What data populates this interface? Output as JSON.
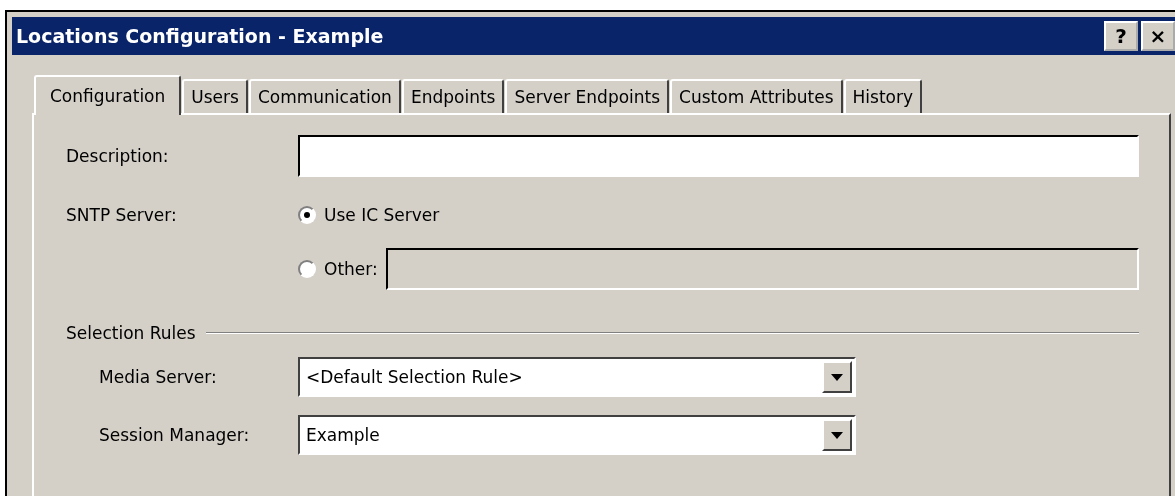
{
  "window": {
    "title": "Locations Configuration - Example",
    "title_buttons": [
      "?",
      "×"
    ]
  },
  "tabs": [
    {
      "label": "Configuration",
      "selected": true
    },
    {
      "label": "Users",
      "selected": false
    },
    {
      "label": "Communication",
      "selected": false
    },
    {
      "label": "Endpoints",
      "selected": false
    },
    {
      "label": "Server Endpoints",
      "selected": false
    },
    {
      "label": "Custom Attributes",
      "selected": false
    },
    {
      "label": "History",
      "selected": false
    }
  ],
  "description": {
    "label": "Description:"
  },
  "sntp_server": {
    "label": "SNTP Server:",
    "options": [
      {
        "label": "Use IC Server",
        "selected": true
      },
      {
        "label": "Other:",
        "selected": false
      }
    ],
    "other_field": {
      "disabled": true
    }
  },
  "selection_rules": {
    "title": "Selection Rules",
    "fields": [
      {
        "label": "Media Server:",
        "value": "<Default Selection Rule>"
      },
      {
        "label": "Session Manager:",
        "value": "Example"
      }
    ]
  }
}
